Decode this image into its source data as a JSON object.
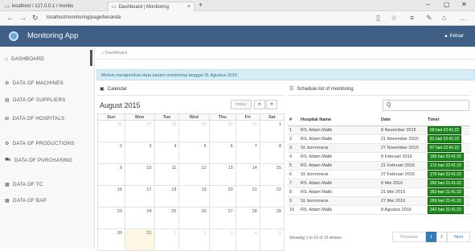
{
  "browser": {
    "tab_inactive": "localhost / 127.0.0.1 / monito",
    "tab_active": "Dashboard | Monitoring",
    "new_tab": "+",
    "url": "localhost/monitoring/page/beranda"
  },
  "app": {
    "title": "Monitoring App",
    "logout": "Keluar"
  },
  "sidebar": {
    "items": [
      {
        "label": "DASHBOARD",
        "icon": "⌂"
      },
      {
        "label": "DATA OF MACHINES",
        "icon": "⚙"
      },
      {
        "label": "DATA OF SUPPLIERS",
        "icon": "▤"
      },
      {
        "label": "DATA OF HOSPITALS",
        "icon": "⊞"
      },
      {
        "label": "DATA OF PRODUCTIONS",
        "icon": "⚙"
      },
      {
        "label": "DATA OF PURCHASING",
        "icon": "⛟"
      },
      {
        "label": "DATA OF TC",
        "icon": "▦"
      },
      {
        "label": "DATA OF BAP",
        "icon": "▦"
      }
    ]
  },
  "breadcrumb": "Dashboard",
  "alert": "Mohon mengirimkan data pasien monitoring tanggal 31 Agustus 2015",
  "calendar": {
    "title": "Calendar",
    "month": "August 2015",
    "today_label": "today",
    "prev": "<",
    "next": ">",
    "days": [
      "Sun",
      "Mon",
      "Tue",
      "Wed",
      "Thu",
      "Fri",
      "Sat"
    ],
    "weeks": [
      [
        {
          "d": "26",
          "o": true
        },
        {
          "d": "27",
          "o": true
        },
        {
          "d": "28",
          "o": true
        },
        {
          "d": "29",
          "o": true
        },
        {
          "d": "30",
          "o": true
        },
        {
          "d": "31",
          "o": true
        },
        {
          "d": "1",
          "o": false
        }
      ],
      [
        {
          "d": "2",
          "o": false
        },
        {
          "d": "3",
          "o": false
        },
        {
          "d": "4",
          "o": false
        },
        {
          "d": "5",
          "o": false
        },
        {
          "d": "6",
          "o": false
        },
        {
          "d": "7",
          "o": false
        },
        {
          "d": "8",
          "o": false
        }
      ],
      [
        {
          "d": "9",
          "o": false
        },
        {
          "d": "10",
          "o": false
        },
        {
          "d": "11",
          "o": false
        },
        {
          "d": "12",
          "o": false
        },
        {
          "d": "13",
          "o": false
        },
        {
          "d": "14",
          "o": false
        },
        {
          "d": "15",
          "o": false
        }
      ],
      [
        {
          "d": "16",
          "o": false
        },
        {
          "d": "17",
          "o": false
        },
        {
          "d": "18",
          "o": false
        },
        {
          "d": "19",
          "o": false
        },
        {
          "d": "20",
          "o": false
        },
        {
          "d": "21",
          "o": false
        },
        {
          "d": "22",
          "o": false
        }
      ],
      [
        {
          "d": "23",
          "o": false
        },
        {
          "d": "24",
          "o": false
        },
        {
          "d": "25",
          "o": false
        },
        {
          "d": "26",
          "o": false
        },
        {
          "d": "27",
          "o": false
        },
        {
          "d": "28",
          "o": false
        },
        {
          "d": "29",
          "o": false
        }
      ],
      [
        {
          "d": "30",
          "o": false
        },
        {
          "d": "31",
          "o": false,
          "today": true
        },
        {
          "d": "1",
          "o": true
        },
        {
          "d": "2",
          "o": true
        },
        {
          "d": "3",
          "o": true
        },
        {
          "d": "4",
          "o": true
        },
        {
          "d": "5",
          "o": true
        }
      ]
    ]
  },
  "schedule": {
    "title": "Schedule list of monitoring",
    "search_icon": "Q",
    "columns": [
      "#",
      "Hospital Name",
      "Date",
      "Timer"
    ],
    "rows": [
      [
        "1",
        "RS. Adam Malik",
        "8 November 2015",
        "68 hari 22:41:22"
      ],
      [
        "2",
        "RS. Adam Malik",
        "21 November 2015",
        "81 hari 22:41:22"
      ],
      [
        "3",
        "St. borromeus",
        "27 November 2015",
        "87 hari 22:41:22"
      ],
      [
        "4",
        "RS. Adam Malik",
        "8 Februari 2016",
        "160 hari 22:41:22"
      ],
      [
        "5",
        "RS. Adam Malik",
        "21 Februari 2016",
        "173 hari 22:41:22"
      ],
      [
        "6",
        "St. borromeus",
        "27 Februari 2016",
        "179 hari 22:41:22"
      ],
      [
        "7",
        "RS. Adam Malik",
        "8 Mei 2016",
        "250 hari 21:41:22"
      ],
      [
        "8",
        "RS. Adam Malik",
        "21 Mei 2016",
        "263 hari 21:41:22"
      ],
      [
        "9",
        "St. borromeus",
        "27 Mei 2016",
        "269 hari 21:41:22"
      ],
      [
        "10",
        "RS. Adam Malik",
        "8 Agustus 2016",
        "342 hari 21:41:22"
      ]
    ],
    "showing": "Showing 1 to 10 of 15 entries",
    "previous": "Previous",
    "page1": "1",
    "page2": "2",
    "next": "Next"
  }
}
